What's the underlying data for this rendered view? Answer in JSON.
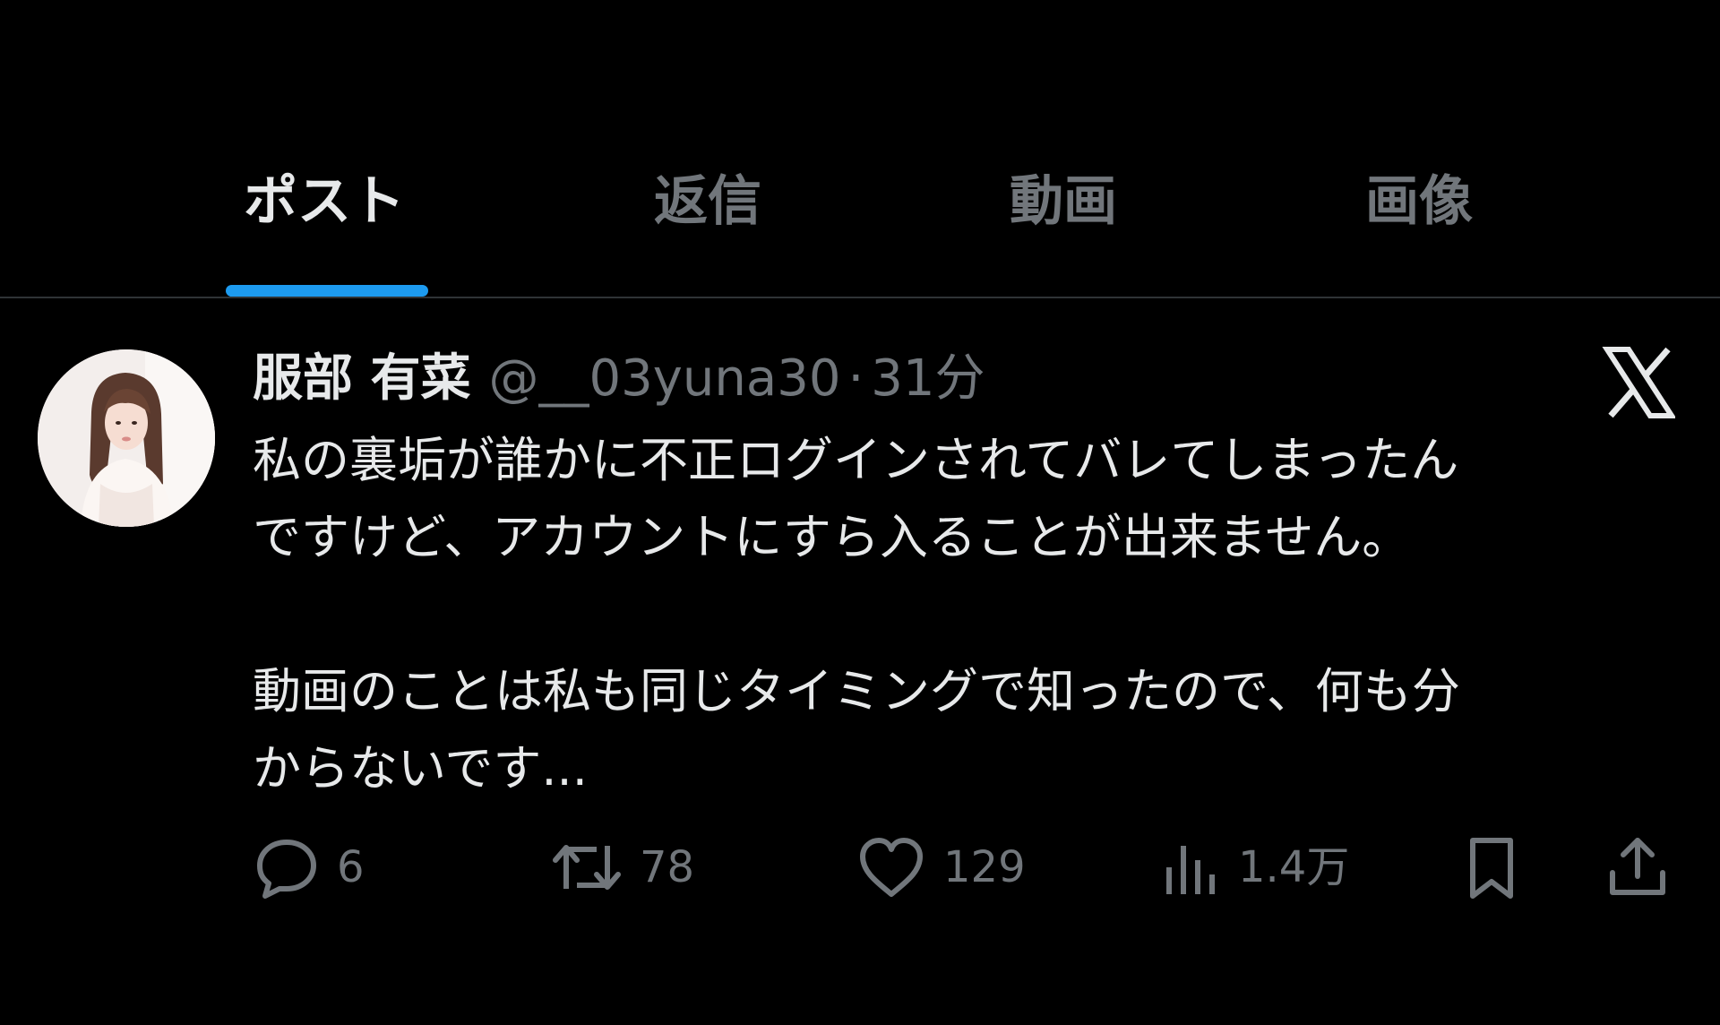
{
  "tabs": [
    {
      "label": "ポスト",
      "active": true
    },
    {
      "label": "返信",
      "active": false
    },
    {
      "label": "動画",
      "active": false
    },
    {
      "label": "画像",
      "active": false
    }
  ],
  "post": {
    "author": {
      "display_name": "服部 有菜",
      "handle": "@__03yuna30"
    },
    "separator": "·",
    "time": "31分",
    "lines": [
      "私の裏垢が誰かに不正ログインされてバレてしまったん",
      "ですけど、アカウントにすら入ることが出来ません。",
      "",
      "動画のことは私も同じタイミングで知ったので、何も分",
      "からないです..."
    ],
    "actions": {
      "reply_count": "6",
      "retweet_count": "78",
      "like_count": "129",
      "views_count": "1.4万"
    }
  },
  "icons": {
    "reply": "reply-icon",
    "retweet": "retweet-icon",
    "like": "heart-icon",
    "views": "views-icon",
    "bookmark": "bookmark-icon",
    "share": "share-icon",
    "logo": "x-logo-icon"
  },
  "colors": {
    "background": "#000000",
    "primary_text": "#e7e9ea",
    "secondary_text": "#71767b",
    "accent": "#1d9bf0",
    "divider": "#2f3336"
  }
}
